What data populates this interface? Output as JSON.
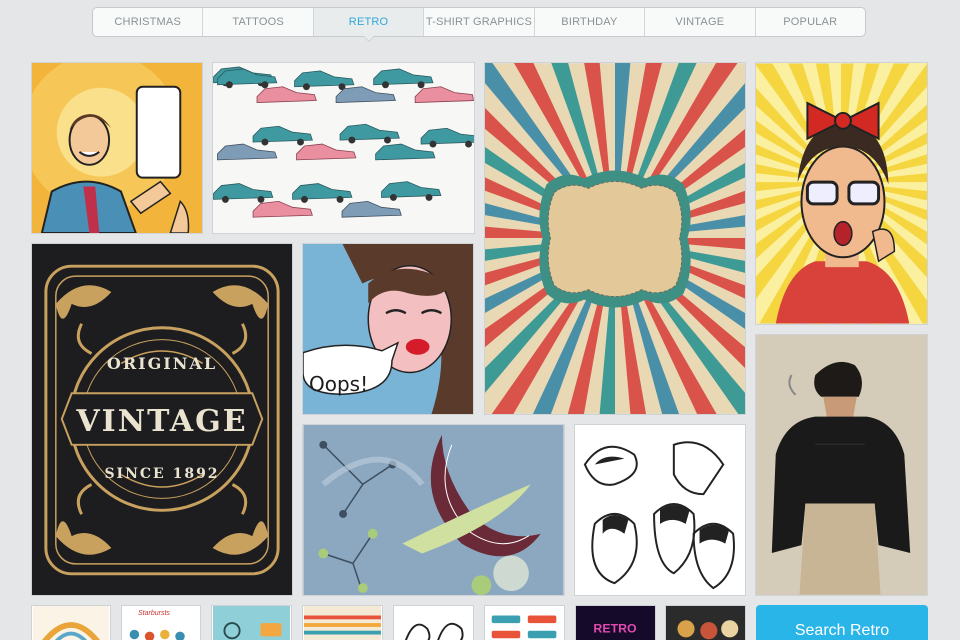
{
  "tabs": [
    {
      "label": "CHRISTMAS",
      "active": false
    },
    {
      "label": "TATTOOS",
      "active": false
    },
    {
      "label": "RETRO",
      "active": true
    },
    {
      "label": "T-SHIRT GRAPHICS",
      "active": false
    },
    {
      "label": "BIRTHDAY",
      "active": false
    },
    {
      "label": "VINTAGE",
      "active": false
    },
    {
      "label": "POPULAR",
      "active": false
    }
  ],
  "tiles": {
    "oops_text": "Oops!",
    "vintage_line1": "ORIGINAL",
    "vintage_line2": "VINTAGE",
    "vintage_line3": "SINCE 1892"
  },
  "thumbs": {
    "starbursts_label": "Starbursts",
    "retro_label": "RETRO"
  },
  "search_button": "Search Retro",
  "colors": {
    "accent": "#29b5e8",
    "active_tab_text": "#2fa8d8",
    "tab_text": "#8a9296",
    "background": "#e4e6e7"
  }
}
